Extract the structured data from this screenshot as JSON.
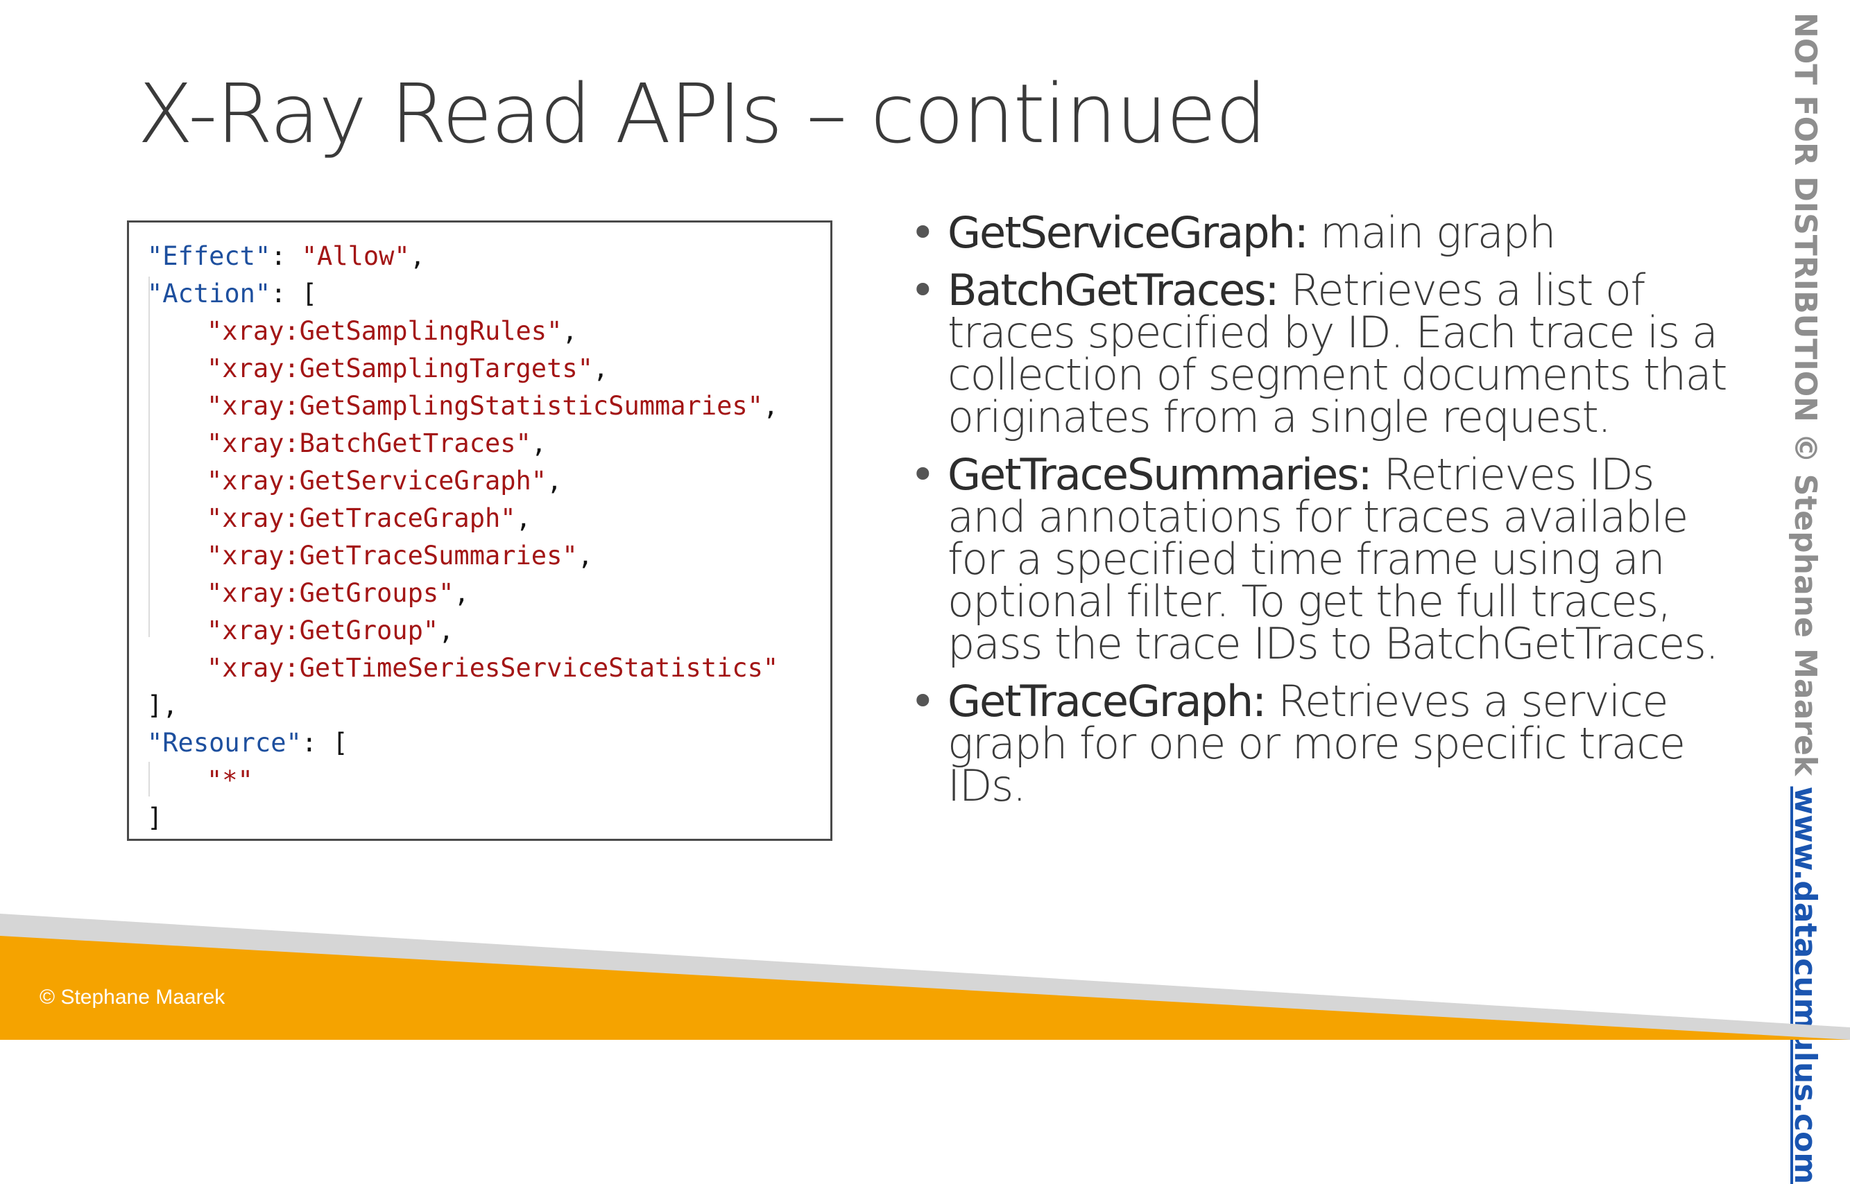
{
  "slide": {
    "title": "X-Ray Read APIs – continued"
  },
  "code": {
    "effect_key": "\"Effect\"",
    "effect_value": "\"Allow\"",
    "action_key": "\"Action\"",
    "actions": [
      "\"xray:GetSamplingRules\"",
      "\"xray:GetSamplingTargets\"",
      "\"xray:GetSamplingStatisticSummaries\"",
      "\"xray:BatchGetTraces\"",
      "\"xray:GetServiceGraph\"",
      "\"xray:GetTraceGraph\"",
      "\"xray:GetTraceSummaries\"",
      "\"xray:GetGroups\"",
      "\"xray:GetGroup\"",
      "\"xray:GetTimeSeriesServiceStatistics\""
    ],
    "resource_key": "\"Resource\"",
    "resource_value": "\"*\""
  },
  "bullets": [
    {
      "term": "GetServiceGraph:",
      "text": " main graph"
    },
    {
      "term": "BatchGetTraces:",
      "text": " Retrieves a list of traces specified by ID. Each trace is a collection of segment documents that originates from a single request."
    },
    {
      "term": "GetTraceSummaries:",
      "text": " Retrieves IDs and annotations for traces available for a specified time frame using an optional filter. To get the full traces, pass the trace IDs to BatchGetTraces."
    },
    {
      "term": "GetTraceGraph:",
      "text": " Retrieves a service graph for one or more specific trace IDs."
    }
  ],
  "watermark": {
    "notice": "NOT FOR DISTRIBUTION © Stephane Maarek ",
    "link": "www.datacumulus.com"
  },
  "footer": {
    "copyright": "© Stephane Maarek"
  },
  "colors": {
    "footer_orange": "#f5a300",
    "footer_grey": "#d6d6d6",
    "json_key_blue": "#1d4f9e",
    "json_string_red": "#a31515",
    "link_blue": "#1a55b0"
  }
}
